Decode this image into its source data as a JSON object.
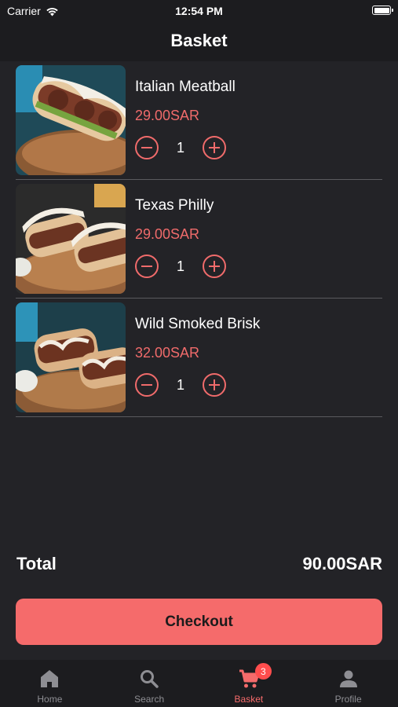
{
  "status_bar": {
    "carrier": "Carrier",
    "time": "12:54 PM"
  },
  "header": {
    "title": "Basket"
  },
  "items": [
    {
      "name": "Italian Meatball",
      "price": "29.00SAR",
      "quantity": "1"
    },
    {
      "name": "Texas Philly",
      "price": "29.00SAR",
      "quantity": "1"
    },
    {
      "name": "Wild Smoked Brisk",
      "price": "32.00SAR",
      "quantity": "1"
    }
  ],
  "total": {
    "label": "Total",
    "value": "90.00SAR"
  },
  "checkout_label": "Checkout",
  "tabbar": {
    "tabs": [
      {
        "label": "Home",
        "icon": "home-icon"
      },
      {
        "label": "Search",
        "icon": "search-icon"
      },
      {
        "label": "Basket",
        "icon": "cart-icon",
        "badge": "3",
        "active": true
      },
      {
        "label": "Profile",
        "icon": "profile-icon"
      }
    ]
  },
  "colors": {
    "accent": "#f56b6b",
    "background": "#232327",
    "bar": "#1c1c1f",
    "badge": "#ff4d4d"
  }
}
